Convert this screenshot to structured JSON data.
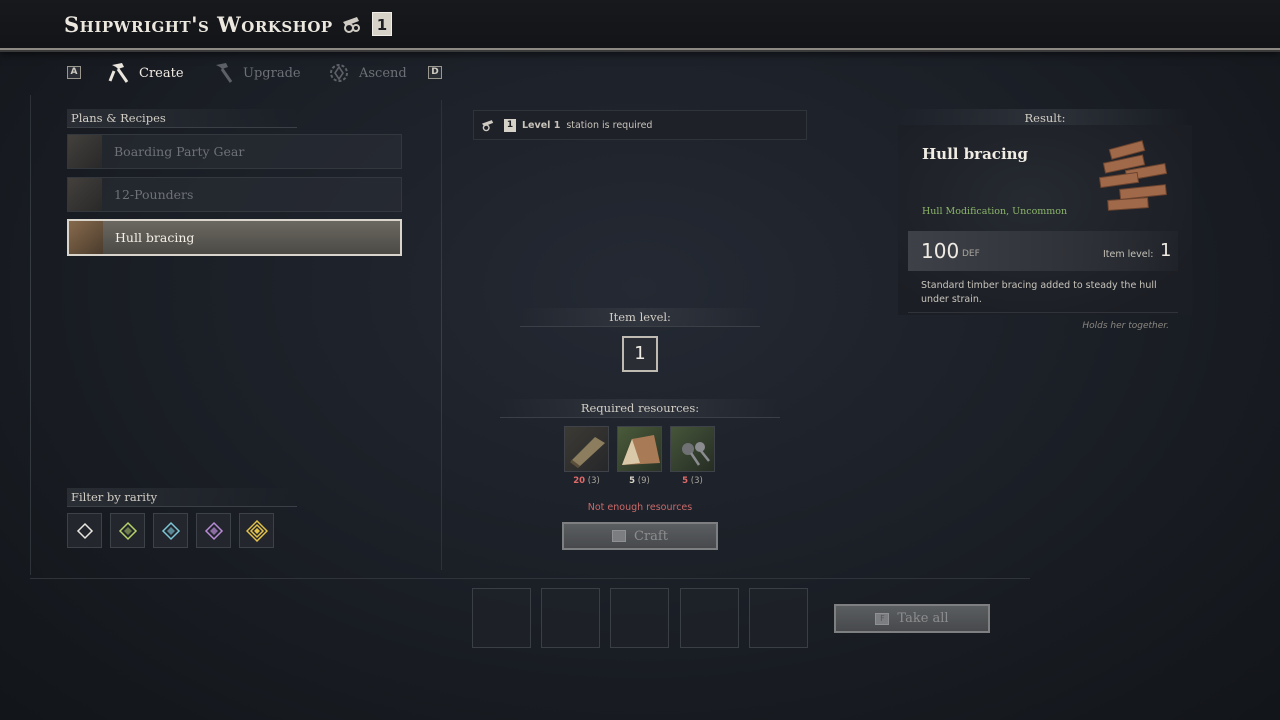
{
  "header": {
    "title": "Shipwright's Workshop",
    "station_level": "1"
  },
  "tabs": {
    "left_key": "A",
    "right_key": "D",
    "items": [
      {
        "label": "Create",
        "icon": "hammer-icon",
        "active": true
      },
      {
        "label": "Upgrade",
        "icon": "hammer-icon",
        "active": false
      },
      {
        "label": "Ascend",
        "icon": "ascend-gear-icon",
        "active": false
      }
    ]
  },
  "recipes": {
    "heading": "Plans & Recipes",
    "items": [
      {
        "label": "Boarding Party Gear",
        "selected": false
      },
      {
        "label": "12-Pounders",
        "selected": false
      },
      {
        "label": "Hull bracing",
        "selected": true
      }
    ]
  },
  "filter": {
    "heading": "Filter by rarity",
    "rarities": [
      {
        "name": "common",
        "color": "#e8e6e0"
      },
      {
        "name": "uncommon",
        "color": "#b6d36a"
      },
      {
        "name": "rare",
        "color": "#7cc6d6"
      },
      {
        "name": "epic",
        "color": "#b98ad6"
      },
      {
        "name": "legendary",
        "color": "#e3c24a"
      }
    ]
  },
  "station": {
    "level_text": "Level 1",
    "suffix": "station is required",
    "badge": "1"
  },
  "item_level": {
    "heading": "Item level:",
    "value": "1"
  },
  "resources": {
    "heading": "Required resources:",
    "items": [
      {
        "name": "timber-resource-icon",
        "have": "20",
        "need": "(3)",
        "have_color": "#e06a6a"
      },
      {
        "name": "ingot-resource-icon",
        "have": "5",
        "need": "(9)",
        "have_color": "#d9d4c8"
      },
      {
        "name": "nails-resource-icon",
        "have": "5",
        "need": "(3)",
        "have_color": "#e06a6a"
      }
    ],
    "warning": "Not enough resources"
  },
  "craft_button": {
    "label": "Craft"
  },
  "take_all_button": {
    "label": "Take all",
    "key": "F"
  },
  "result": {
    "heading": "Result:",
    "name": "Hull bracing",
    "type": "Hull Modification, Uncommon",
    "stat_value": "100",
    "stat_unit": "DEF",
    "item_level_label": "Item level:",
    "item_level_value": "1",
    "description": "Standard timber bracing added to steady the hull under strain.",
    "flavor": "Holds her together.",
    "type_color": "#8bb56a"
  }
}
